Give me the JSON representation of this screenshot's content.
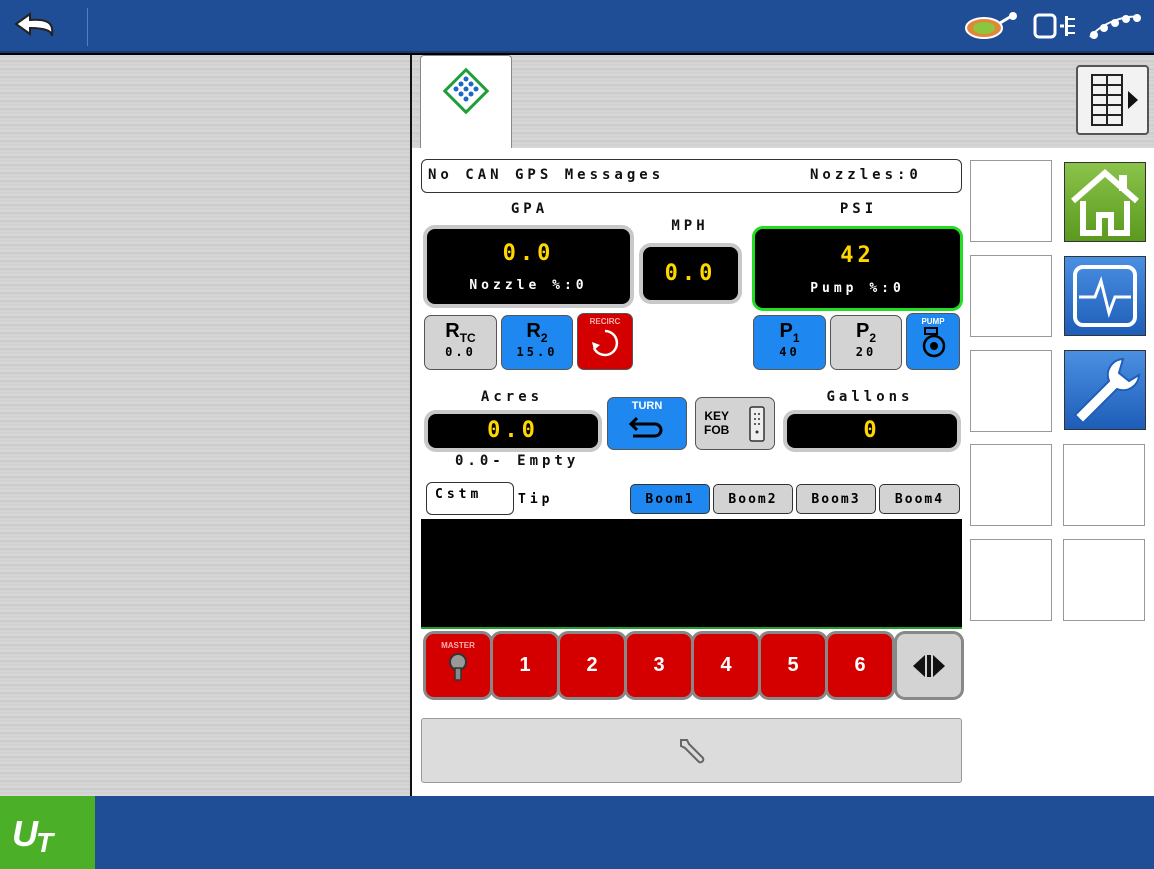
{
  "status": {
    "message": "No CAN GPS Messages",
    "nozzles": "Nozzles:0"
  },
  "gpa": {
    "label": "GPA",
    "value": "0.0",
    "sub": "Nozzle %:0"
  },
  "mph": {
    "label": "MPH",
    "value": "0.0"
  },
  "psi": {
    "label": "PSI",
    "value": "42",
    "sub": "Pump %:0"
  },
  "rate_buttons": {
    "rtc": {
      "label": "R",
      "sub_label": "TC",
      "value": "0.0"
    },
    "r2": {
      "label": "R",
      "sub_label": "2",
      "value": "15.0"
    },
    "recirc": {
      "label": "RECIRC"
    },
    "p1": {
      "label": "P",
      "sub_label": "1",
      "value": "40"
    },
    "p2": {
      "label": "P",
      "sub_label": "2",
      "value": "20"
    },
    "pump": {
      "label": "PUMP"
    }
  },
  "acres": {
    "label": "Acres",
    "value": "0.0",
    "sub": "0.0- Empty"
  },
  "gallons": {
    "label": "Gallons",
    "value": "0"
  },
  "turn": {
    "label": "TURN"
  },
  "keyfob": {
    "line1": "KEY",
    "line2": "FOB"
  },
  "tip": {
    "cstm": "Cstm",
    "label": "Tip"
  },
  "booms": [
    "Boom1",
    "Boom2",
    "Boom3",
    "Boom4"
  ],
  "master": {
    "label": "MASTER"
  },
  "sections": [
    "1",
    "2",
    "3",
    "4",
    "5",
    "6"
  ],
  "colors": {
    "topbar": "#1f4e96",
    "accent_blue": "#1e88f0",
    "section_red": "#d40000",
    "value_yellow": "#ffd700",
    "psi_border_green": "#22dd22",
    "home_green": "#6aaa2a"
  },
  "icons": {
    "back": "undo-arrow-icon",
    "gps": "gps-satellite-icon",
    "display": "display-icon",
    "implement": "implement-icon",
    "tab": "diamond-grid-icon",
    "grid": "grid-menu-icon",
    "home": "home-icon",
    "diagnostics": "diagnostics-icon",
    "settings": "wrench-icon",
    "footer_wrench": "wrench-icon",
    "ut": "ut-logo"
  }
}
